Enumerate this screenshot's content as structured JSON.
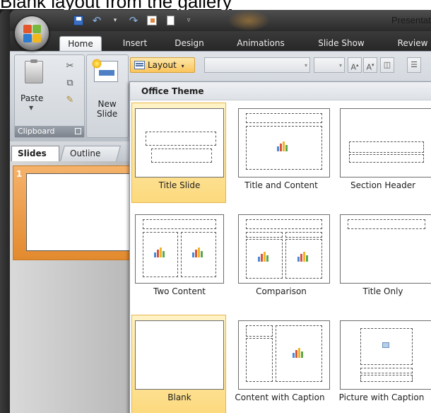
{
  "caption": "Blank layout from the gallery",
  "window": {
    "title": "Presentati",
    "qat": [
      "save",
      "undo",
      "redo",
      "new",
      "open"
    ]
  },
  "tabs": [
    "Home",
    "Insert",
    "Design",
    "Animations",
    "Slide Show",
    "Review"
  ],
  "active_tab": "Home",
  "ribbon": {
    "paste_label": "Paste",
    "new_slide_label": "New\nSlide",
    "clipboard_label": "Clipboard",
    "layout_label": "Layout"
  },
  "panes": {
    "slides_tab": "Slides",
    "outline_tab": "Outline",
    "slide_number": "1"
  },
  "gallery": {
    "header": "Office Theme",
    "layouts": [
      {
        "name": "Title Slide"
      },
      {
        "name": "Title and Content"
      },
      {
        "name": "Section Header"
      },
      {
        "name": "Two Content"
      },
      {
        "name": "Comparison"
      },
      {
        "name": "Title Only"
      },
      {
        "name": "Blank"
      },
      {
        "name": "Content with Caption"
      },
      {
        "name": "Picture with Caption"
      }
    ],
    "selected": [
      "Title Slide",
      "Blank"
    ]
  },
  "colors": {
    "accent_orange": "#f9c45c",
    "selection_fill": "#fcd97d",
    "frame_dark": "#2a2a2a"
  }
}
